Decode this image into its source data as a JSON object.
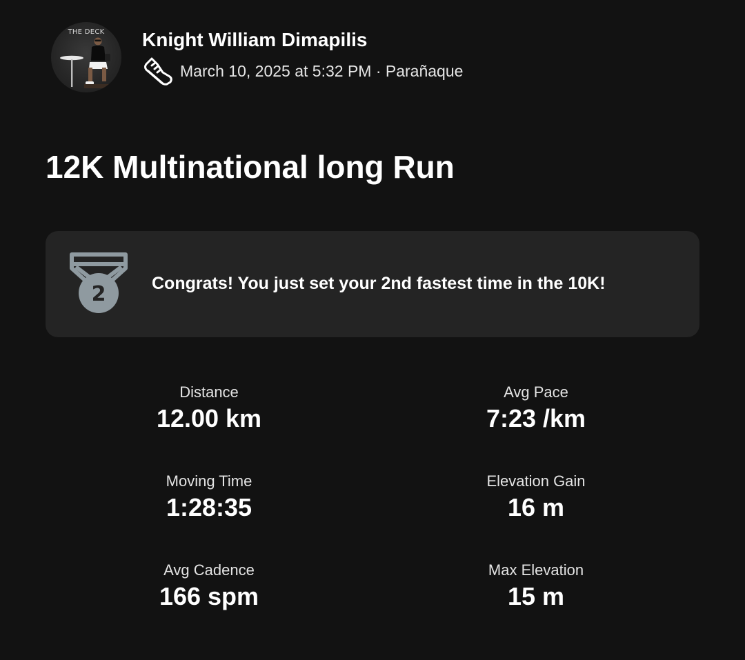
{
  "header": {
    "avatar_caption": "THE DECK",
    "athlete_name": "Knight William Dimapilis",
    "activity_icon": "running-shoe-icon",
    "meta": "March 10, 2025 at 5:32 PM · Parañaque"
  },
  "activity": {
    "title": "12K Multinational long Run"
  },
  "achievement": {
    "icon": "medal-icon",
    "medal_rank": "2",
    "text": "Congrats! You just set your 2nd fastest time in the 10K!"
  },
  "stats": [
    {
      "label": "Distance",
      "value": "12.00 km"
    },
    {
      "label": "Avg Pace",
      "value": "7:23 /km"
    },
    {
      "label": "Moving Time",
      "value": "1:28:35"
    },
    {
      "label": "Elevation Gain",
      "value": "16 m"
    },
    {
      "label": "Avg Cadence",
      "value": "166 spm"
    },
    {
      "label": "Max Elevation",
      "value": "15 m"
    }
  ],
  "colors": {
    "background": "#121212",
    "card": "#242424",
    "medal": "#8f9aa0",
    "text": "#ffffff"
  }
}
